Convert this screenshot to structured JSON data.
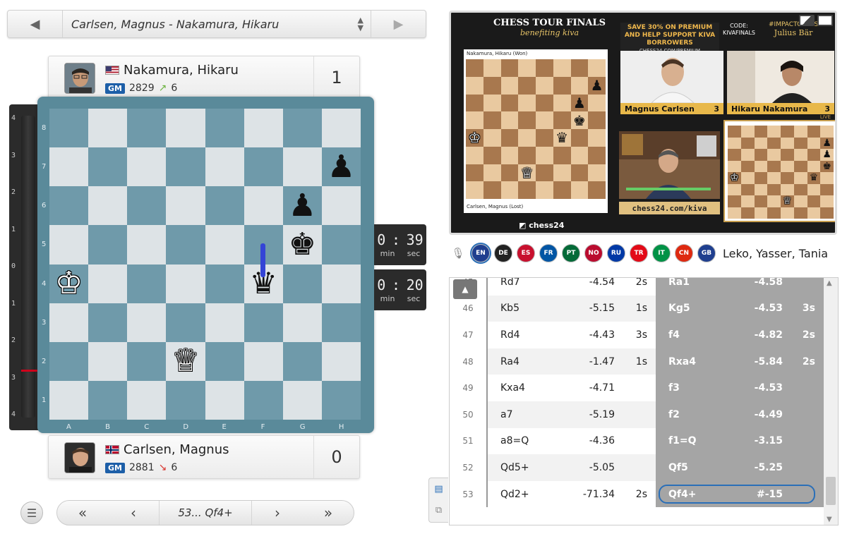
{
  "selector": {
    "title": "Carlsen, Magnus - Nakamura, Hikaru"
  },
  "players": {
    "top": {
      "name": "Nakamura, Hikaru",
      "title": "GM",
      "rating": "2829",
      "change": "6",
      "trend": "up",
      "score": "1"
    },
    "bottom": {
      "name": "Carlsen, Magnus",
      "title": "GM",
      "rating": "2881",
      "change": "6",
      "trend": "down",
      "score": "0"
    }
  },
  "eval_ticks": [
    "4",
    "3",
    "2",
    "1",
    "0",
    "1",
    "2",
    "3",
    "4"
  ],
  "board": {
    "files": [
      "A",
      "B",
      "C",
      "D",
      "E",
      "F",
      "G",
      "H"
    ],
    "ranks": [
      "8",
      "7",
      "6",
      "5",
      "4",
      "3",
      "2",
      "1"
    ],
    "pieces": [
      {
        "square": "h7",
        "glyph": "♟",
        "color": "b"
      },
      {
        "square": "g6",
        "glyph": "♟",
        "color": "b"
      },
      {
        "square": "g5",
        "glyph": "♚",
        "color": "b"
      },
      {
        "square": "f4",
        "glyph": "♛",
        "color": "b"
      },
      {
        "square": "a4",
        "glyph": "♔",
        "color": "w"
      },
      {
        "square": "d2",
        "glyph": "♕",
        "color": "w"
      }
    ]
  },
  "clocks": {
    "top": {
      "min": "0",
      "sec": "39",
      "min_label": "min",
      "sec_label": "sec"
    },
    "bottom": {
      "min": "0",
      "sec": "20",
      "min_label": "min",
      "sec_label": "sec"
    }
  },
  "nav": {
    "current_move": "53... Qf4+"
  },
  "video": {
    "header": "CHESS TOUR FINALS",
    "header_sub": "benefiting kiva",
    "promo": "SAVE 30% ON PREMIUM AND HELP SUPPORT KIVA BORROWERS",
    "promo_url": "CHESS24.COM/PREMIUM",
    "code_label": "CODE:",
    "code": "KIVAFINALS",
    "sponsor_tag": "#IMPACTCHESS",
    "sponsor": "Julius Bär",
    "white_label": "Nakamura, Hikaru (Won)",
    "black_label": "Carlsen, Magnus (Lost)",
    "cam1_name": "Magnus Carlsen",
    "cam1_score": "3",
    "cam2_name": "Hikaru Nakamura",
    "cam2_score": "3",
    "link": "chess24.com/kiva",
    "logo": "chess24",
    "live": "LIVE"
  },
  "commentary": {
    "names": "Leko, Yasser, Tania",
    "languages": [
      {
        "code": "EN",
        "color": "#1f3f8f"
      },
      {
        "code": "DE",
        "color": "#222222"
      },
      {
        "code": "ES",
        "color": "#c8102e"
      },
      {
        "code": "FR",
        "color": "#0055a4"
      },
      {
        "code": "PT",
        "color": "#046a38"
      },
      {
        "code": "NO",
        "color": "#ba0c2f"
      },
      {
        "code": "RU",
        "color": "#0039a6"
      },
      {
        "code": "TR",
        "color": "#e30a17"
      },
      {
        "code": "IT",
        "color": "#009246"
      },
      {
        "code": "CN",
        "color": "#de2910"
      },
      {
        "code": "GB",
        "color": "#1f3f8f"
      }
    ]
  },
  "moves": [
    {
      "num": "45",
      "w": "Rd7",
      "we": "-4.54",
      "wt": "2s",
      "b": "Ra1",
      "be": "-4.58",
      "bt": ""
    },
    {
      "num": "46",
      "w": "Kb5",
      "we": "-5.15",
      "wt": "1s",
      "b": "Kg5",
      "be": "-4.53",
      "bt": "3s"
    },
    {
      "num": "47",
      "w": "Rd4",
      "we": "-4.43",
      "wt": "3s",
      "b": "f4",
      "be": "-4.82",
      "bt": "2s"
    },
    {
      "num": "48",
      "w": "Ra4",
      "we": "-1.47",
      "wt": "1s",
      "b": "Rxa4",
      "be": "-5.84",
      "bt": "2s"
    },
    {
      "num": "49",
      "w": "Kxa4",
      "we": "-4.71",
      "wt": "",
      "b": "f3",
      "be": "-4.53",
      "bt": ""
    },
    {
      "num": "50",
      "w": "a7",
      "we": "-5.19",
      "wt": "",
      "b": "f2",
      "be": "-4.49",
      "bt": ""
    },
    {
      "num": "51",
      "w": "a8=Q",
      "we": "-4.36",
      "wt": "",
      "b": "f1=Q",
      "be": "-3.15",
      "bt": ""
    },
    {
      "num": "52",
      "w": "Qd5+",
      "we": "-5.05",
      "wt": "",
      "b": "Qf5",
      "be": "-5.25",
      "bt": ""
    },
    {
      "num": "53",
      "w": "Qd2+",
      "we": "-71.34",
      "wt": "2s",
      "b": "Qf4+",
      "be": "#-15",
      "bt": ""
    }
  ]
}
